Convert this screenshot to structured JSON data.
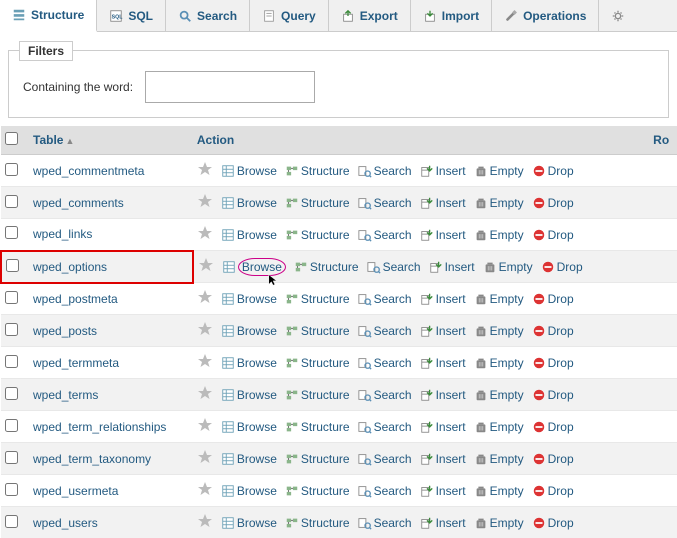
{
  "tabs": [
    {
      "label": "Structure",
      "icon": "structure",
      "active": true
    },
    {
      "label": "SQL",
      "icon": "sql",
      "active": false
    },
    {
      "label": "Search",
      "icon": "search",
      "active": false
    },
    {
      "label": "Query",
      "icon": "query",
      "active": false
    },
    {
      "label": "Export",
      "icon": "export",
      "active": false
    },
    {
      "label": "Import",
      "icon": "import",
      "active": false
    },
    {
      "label": "Operations",
      "icon": "operations",
      "active": false
    }
  ],
  "filters": {
    "legend": "Filters",
    "containing_label": "Containing the word:",
    "containing_value": ""
  },
  "columns": {
    "table": "Table",
    "action": "Action",
    "rows": "Ro"
  },
  "action_labels": {
    "browse": "Browse",
    "structure": "Structure",
    "search": "Search",
    "insert": "Insert",
    "empty": "Empty",
    "drop": "Drop"
  },
  "tables": [
    {
      "name": "wped_commentmeta"
    },
    {
      "name": "wped_comments"
    },
    {
      "name": "wped_links"
    },
    {
      "name": "wped_options",
      "highlight": true,
      "browse_circled": true
    },
    {
      "name": "wped_postmeta"
    },
    {
      "name": "wped_posts"
    },
    {
      "name": "wped_termmeta"
    },
    {
      "name": "wped_terms"
    },
    {
      "name": "wped_term_relationships"
    },
    {
      "name": "wped_term_taxonomy"
    },
    {
      "name": "wped_usermeta"
    },
    {
      "name": "wped_users"
    }
  ]
}
